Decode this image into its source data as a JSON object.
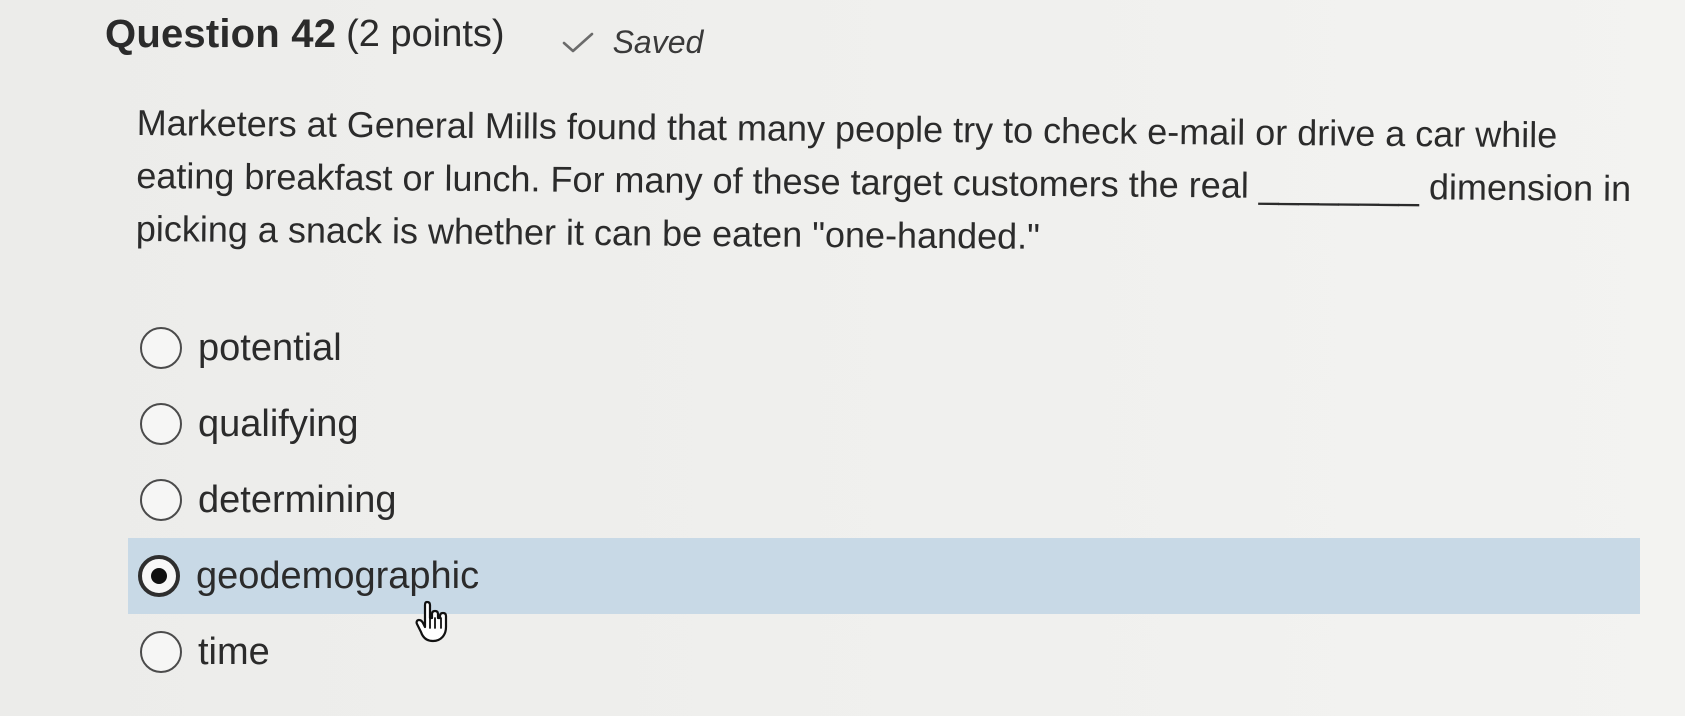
{
  "question": {
    "title": "Question 42",
    "points": "(2 points)",
    "saved_label": "Saved",
    "text": "Marketers at General Mills found that many people try to check e-mail or drive a car while eating breakfast or lunch. For many of these target customers the real ________ dimension in picking a snack is whether it can be eaten \"one-handed.\""
  },
  "options": [
    {
      "label": "potential",
      "selected": false
    },
    {
      "label": "qualifying",
      "selected": false
    },
    {
      "label": "determining",
      "selected": false
    },
    {
      "label": "geodemographic",
      "selected": true
    },
    {
      "label": "time",
      "selected": false
    }
  ],
  "icons": {
    "saved_status": "check-icon",
    "pointer": "hand-pointer-icon"
  },
  "colors": {
    "selected_background": "#c8d9e6",
    "text": "#2b2b2b"
  }
}
